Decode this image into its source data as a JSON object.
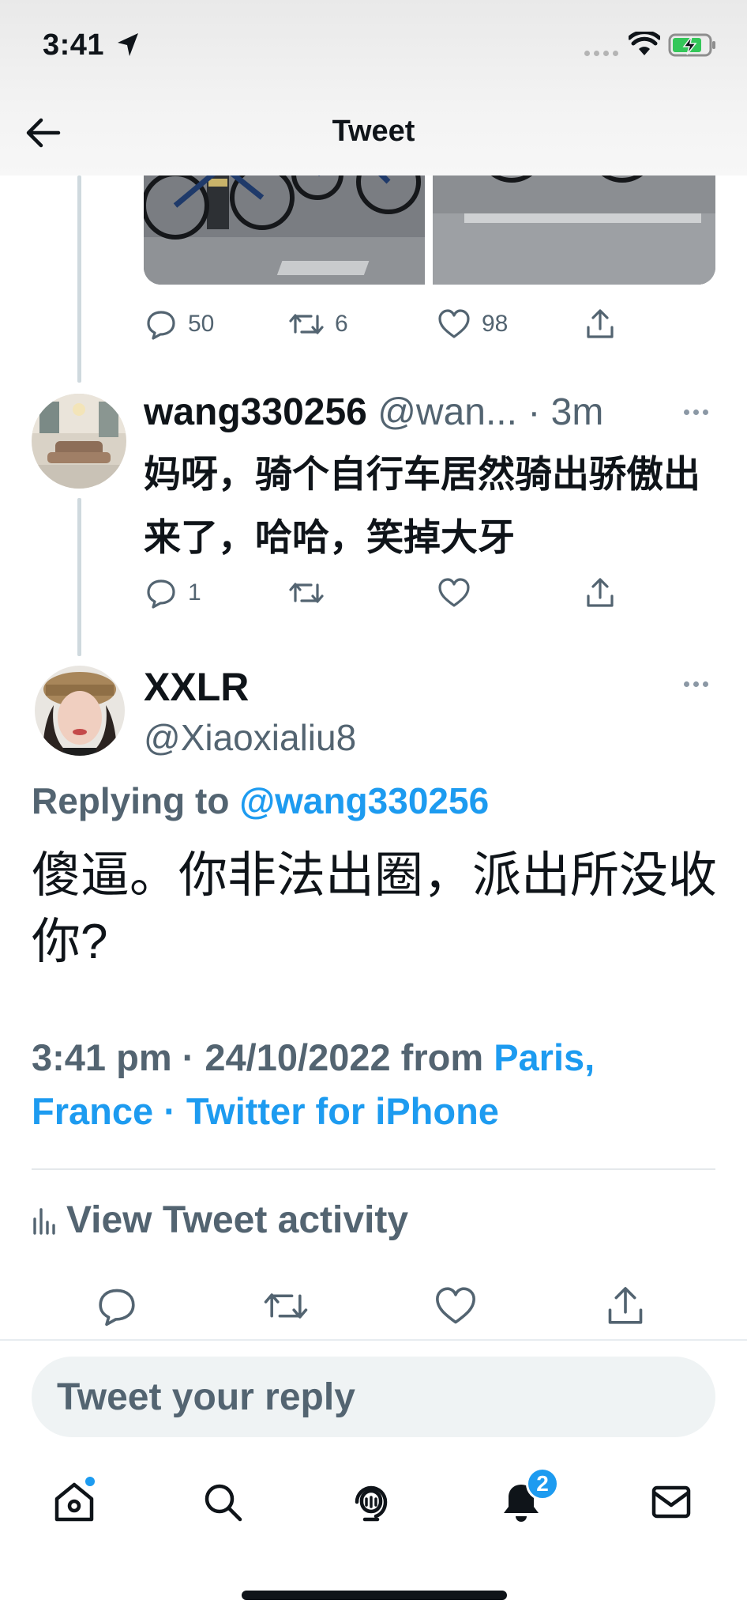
{
  "status_bar": {
    "time": "3:41"
  },
  "nav": {
    "title": "Tweet"
  },
  "previous_tweet": {
    "replies": "50",
    "retweets": "6",
    "likes": "98"
  },
  "reply_tweet": {
    "display_name": "wang330256",
    "handle": "@wan...",
    "dot": " · ",
    "time": "3m",
    "text": "妈呀，骑个自行车居然骑出骄傲出来了，哈哈，笑掉大牙",
    "replies": "1"
  },
  "main_tweet": {
    "display_name": "XXLR",
    "handle": "@Xiaoxialiu8",
    "replying_prefix": "Replying to ",
    "replying_to": "@wang330256",
    "text": "傻逼。你非法出圈，派出所没收你?",
    "meta_time": "3:41 pm · 24/10/2022 from ",
    "meta_location": "Paris, France",
    "meta_sep": " · ",
    "meta_client": "Twitter for iPhone",
    "activity_label": "View Tweet activity"
  },
  "composer": {
    "placeholder": "Tweet your reply"
  },
  "tabbar": {
    "notifications_badge": "2"
  },
  "colors": {
    "accent": "#1d9bf0",
    "secondary_text": "#536471",
    "primary_text": "#0f1419"
  }
}
